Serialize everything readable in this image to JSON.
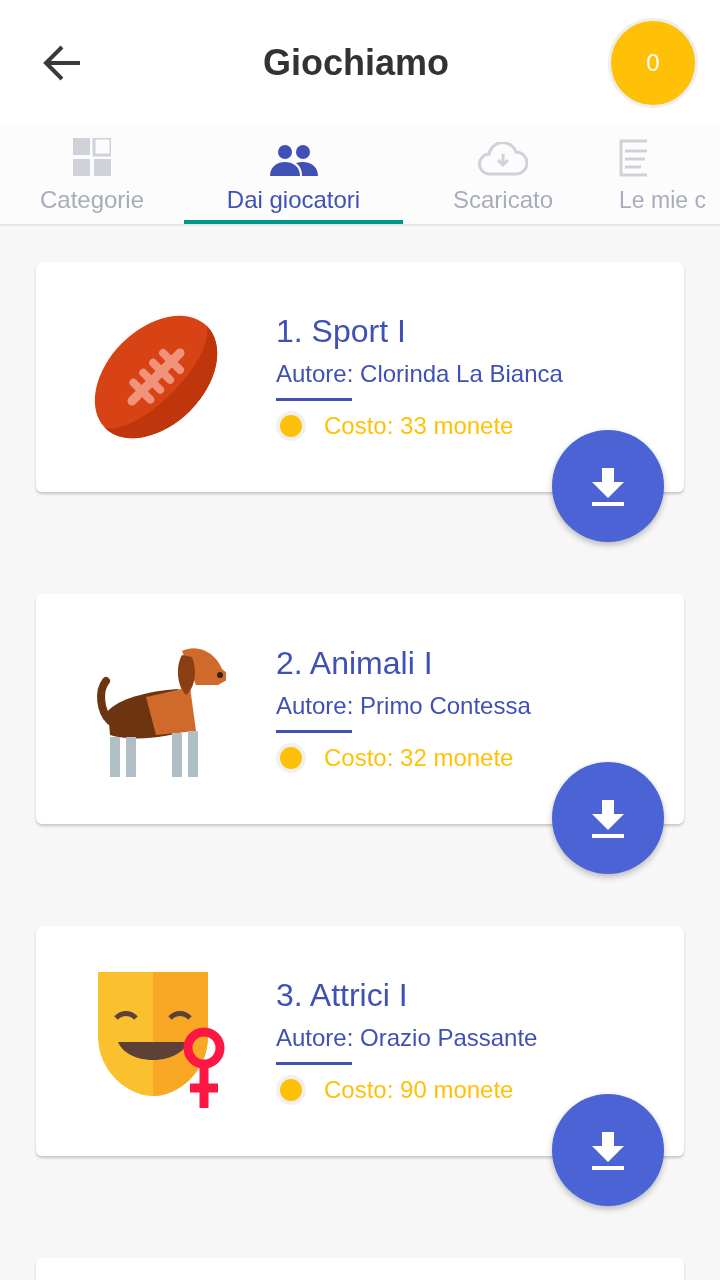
{
  "header": {
    "title": "Giochiamo",
    "coins": "0"
  },
  "tabs": [
    {
      "label": "Categorie",
      "selected": false
    },
    {
      "label": "Dai giocatori",
      "selected": true
    },
    {
      "label": "Scaricato",
      "selected": false
    },
    {
      "label": "Le mie c",
      "selected": false
    }
  ],
  "games": [
    {
      "title": "1. Sport I",
      "author": "Autore: Clorinda La Bianca",
      "cost": "Costo: 33 monete",
      "kind": "ball"
    },
    {
      "title": "2. Animali I",
      "author": "Autore: Primo Contessa",
      "cost": "Costo: 32 monete",
      "kind": "dog"
    },
    {
      "title": "3. Attrici I",
      "author": "Autore: Orazio Passante",
      "cost": "Costo: 90 monete",
      "kind": "mask"
    }
  ]
}
